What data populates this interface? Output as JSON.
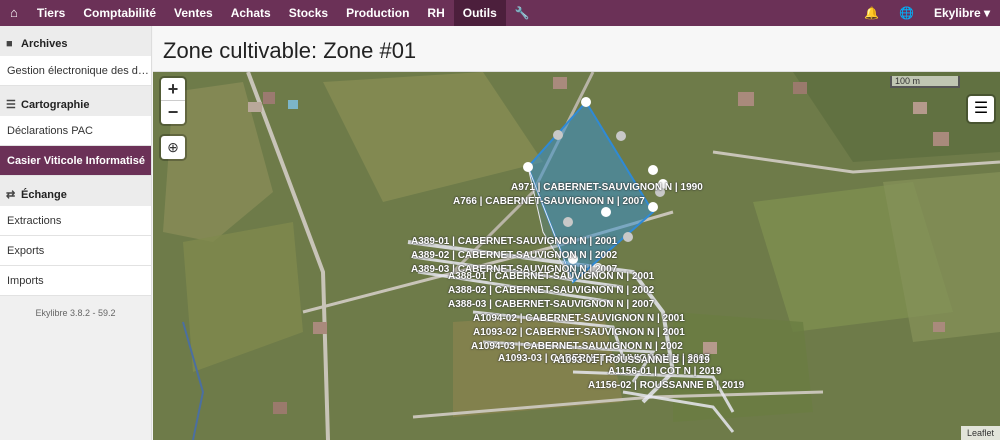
{
  "topbar": {
    "menu": [
      "Tiers",
      "Comptabilité",
      "Ventes",
      "Achats",
      "Stocks",
      "Production",
      "RH",
      "Outils"
    ],
    "user": "Ekylibre"
  },
  "sidebar": {
    "sections": [
      {
        "title": "Archives",
        "items": [
          "Gestion électronique des docu..."
        ]
      },
      {
        "title": "Cartographie",
        "items": [
          "Déclarations PAC",
          "Casier Viticole Informatisé"
        ]
      },
      {
        "title": "Échange",
        "items": [
          "Extractions",
          "Exports",
          "Imports"
        ]
      }
    ],
    "version": "Ekylibre 3.8.2 - 59.2"
  },
  "page": {
    "title": "Zone cultivable: Zone #01"
  },
  "map": {
    "scale": "100 m",
    "attribution": "Leaflet",
    "parcels": [
      "A971 | CABERNET-SAUVIGNON N | 1990",
      "A766 | CABERNET-SAUVIGNON N | 2007",
      "A389-01 | CABERNET-SAUVIGNON N | 2001",
      "A389-02 | CABERNET-SAUVIGNON N | 2002",
      "A389-03 | CABERNET-SAUVIGNON N | 2007",
      "A388-01 | CABERNET-SAUVIGNON N | 2001",
      "A388-02 | CABERNET-SAUVIGNON N | 2002",
      "A388-03 | CABERNET-SAUVIGNON N | 2007",
      "A1094-02 | CABERNET-SAUVIGNON N | 2001",
      "A1093-02 | CABERNET-SAUVIGNON N | 2001",
      "A1094-03 | CABERNET-SAUVIGNON N | 2002",
      "A1093-03 | CABERNET-SAUVIGNON N | 2007",
      "A1093-01 | ROUSSANNE B | 2019",
      "A1156-01 | COT N | 2019",
      "A1156-02 | ROUSSANNE B | 2019"
    ]
  }
}
